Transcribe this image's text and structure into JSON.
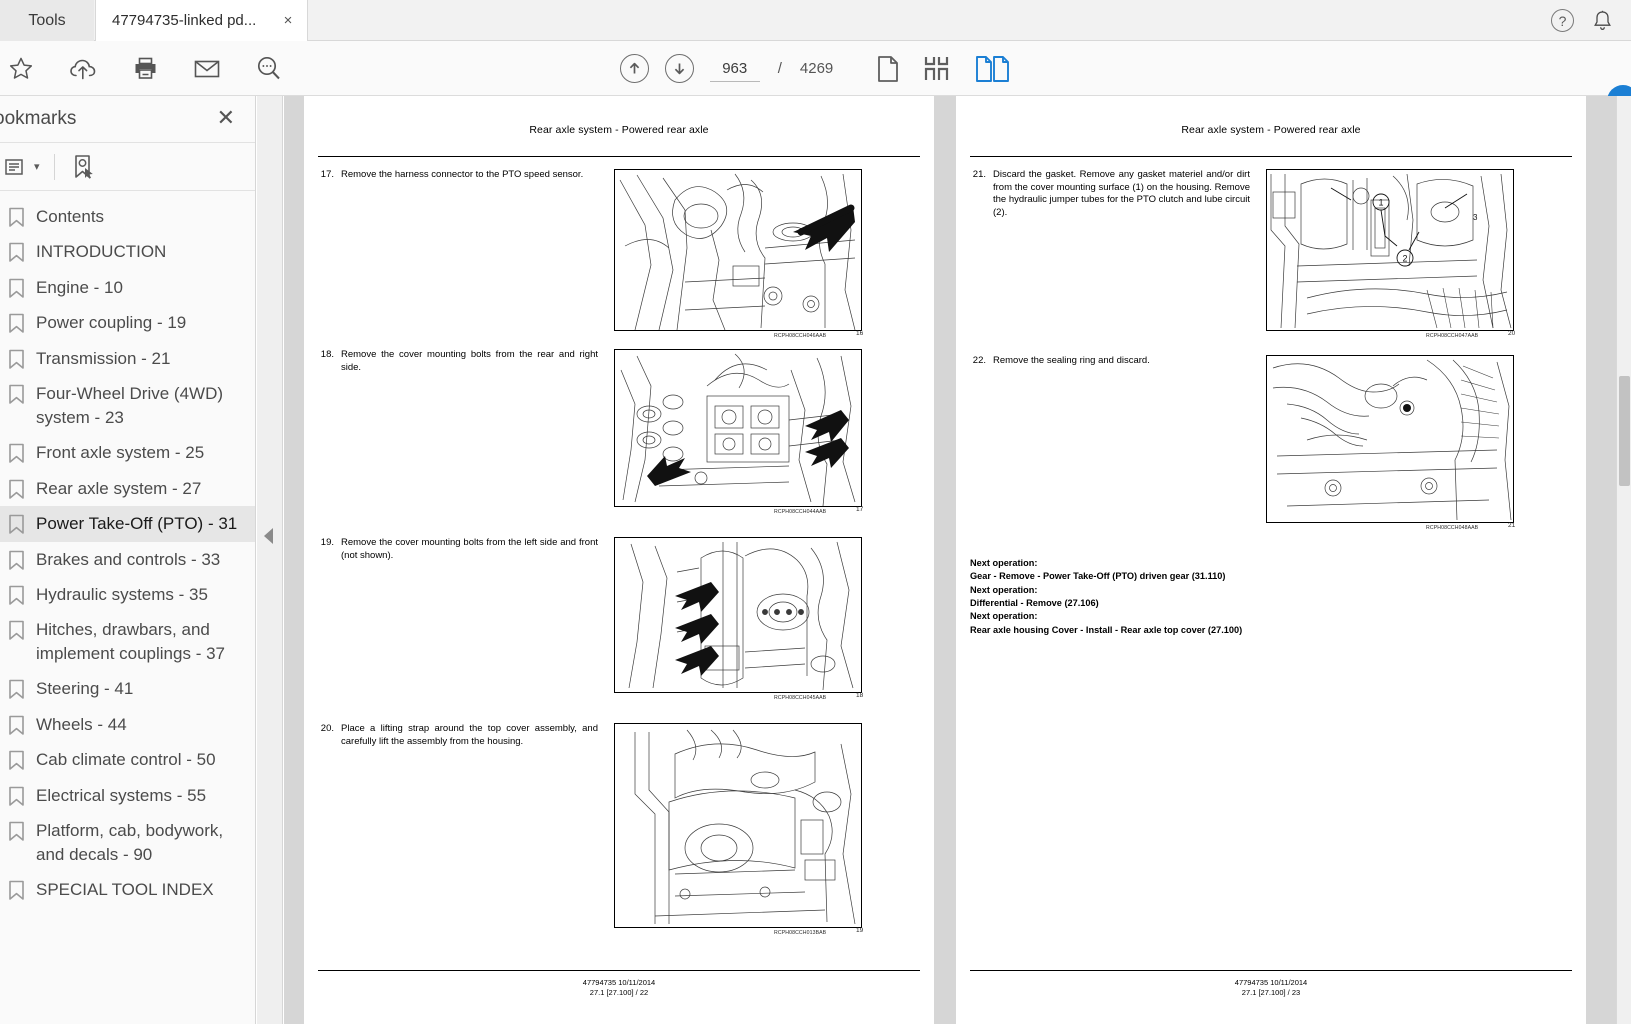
{
  "window": {
    "tools_tab_label": "Tools",
    "document_tab_label": "47794735-linked pd...",
    "close_tab_glyph": "×",
    "help_glyph": "?",
    "help_icon_name": "help-icon",
    "bell_icon_name": "notification-bell-icon"
  },
  "toolbar": {
    "icons": [
      {
        "name": "star-bookmark-icon",
        "label": "Add bookmark"
      },
      {
        "name": "cloud-upload-icon",
        "label": "Save to cloud"
      },
      {
        "name": "print-icon",
        "label": "Print"
      },
      {
        "name": "email-icon",
        "label": "Email"
      },
      {
        "name": "search-icon",
        "label": "Search"
      }
    ],
    "prev_page_label": "Previous page",
    "next_page_label": "Next page",
    "page_number": "963",
    "page_separator": "/",
    "page_total": "4269",
    "view_single_label": "Single page view",
    "view_grid_label": "Page thumbnails view",
    "view_двух_label": "Two page view",
    "active_view": "two-page",
    "accent_color": "#1b7fd4"
  },
  "bookmarks": {
    "title": "ookmarks",
    "close_glyph": "✕",
    "option_list_icon": "list-options-icon",
    "option_caret": "▾",
    "add_bookmark_icon": "new-bookmark-icon",
    "selected_index": 8,
    "items": [
      {
        "label": "Contents"
      },
      {
        "label": "INTRODUCTION"
      },
      {
        "label": "Engine - 10"
      },
      {
        "label": "Power coupling - 19"
      },
      {
        "label": "Transmission - 21"
      },
      {
        "label": "Four-Wheel Drive (4WD) system - 23"
      },
      {
        "label": "Front axle system - 25"
      },
      {
        "label": "Rear axle system - 27"
      },
      {
        "label": "Power Take-Off (PTO) - 31"
      },
      {
        "label": "Brakes and controls - 33"
      },
      {
        "label": "Hydraulic systems - 35"
      },
      {
        "label": "Hitches, drawbars, and implement couplings - 37"
      },
      {
        "label": "Steering - 41"
      },
      {
        "label": "Wheels - 44"
      },
      {
        "label": "Cab climate control - 50"
      },
      {
        "label": "Electrical systems - 55"
      },
      {
        "label": "Platform, cab, bodywork, and decals - 90"
      },
      {
        "label": "SPECIAL TOOL INDEX"
      }
    ]
  },
  "document": {
    "left_page": {
      "header": "Rear axle system - Powered rear axle",
      "steps": [
        {
          "number": "17.",
          "text": "Remove the harness connector to the PTO speed sensor.",
          "figure_code": "RCPH08CCH046AAB",
          "figure_number": "16"
        },
        {
          "number": "18.",
          "text": "Remove the cover mounting bolts from the rear and right side.",
          "figure_code": "RCPH08CCH044AAB",
          "figure_number": "17"
        },
        {
          "number": "19.",
          "text": "Remove the cover mounting bolts from the left side and front (not shown).",
          "figure_code": "RCPH08CCH045AAB",
          "figure_number": "18"
        },
        {
          "number": "20.",
          "text": "Place a lifting strap around the top cover assembly, and carefully lift the assembly from the housing.",
          "figure_code": "RCPH08CCH013BAB",
          "figure_number": "19"
        }
      ],
      "footer_line1": "47794735 10/11/2014",
      "footer_line2": "27.1 [27.100] / 22"
    },
    "right_page": {
      "header": "Rear axle system - Powered rear axle",
      "steps": [
        {
          "number": "21.",
          "text": "Discard the gasket.  Remove any gasket materiel and/or dirt from the cover mounting surface (1) on the housing.  Remove the hydraulic jumper tubes for the PTO clutch and lube circuit (2).",
          "figure_code": "RCPH08CCH047AAB",
          "figure_number": "20",
          "callouts": [
            "1",
            "2",
            "3"
          ]
        },
        {
          "number": "22.",
          "text": "Remove the sealing ring and discard.",
          "figure_code": "RCPH08CCH048AAB",
          "figure_number": "21"
        }
      ],
      "next_operations": [
        "Next operation:",
        "Gear - Remove - Power Take-Off (PTO) driven gear (31.110)",
        "Next operation:",
        "Differential - Remove (27.106)",
        "Next operation:",
        "Rear axle housing Cover - Install - Rear axle top cover (27.100)"
      ],
      "footer_line1": "47794735 10/11/2014",
      "footer_line2": "27.1 [27.100] / 23"
    }
  }
}
